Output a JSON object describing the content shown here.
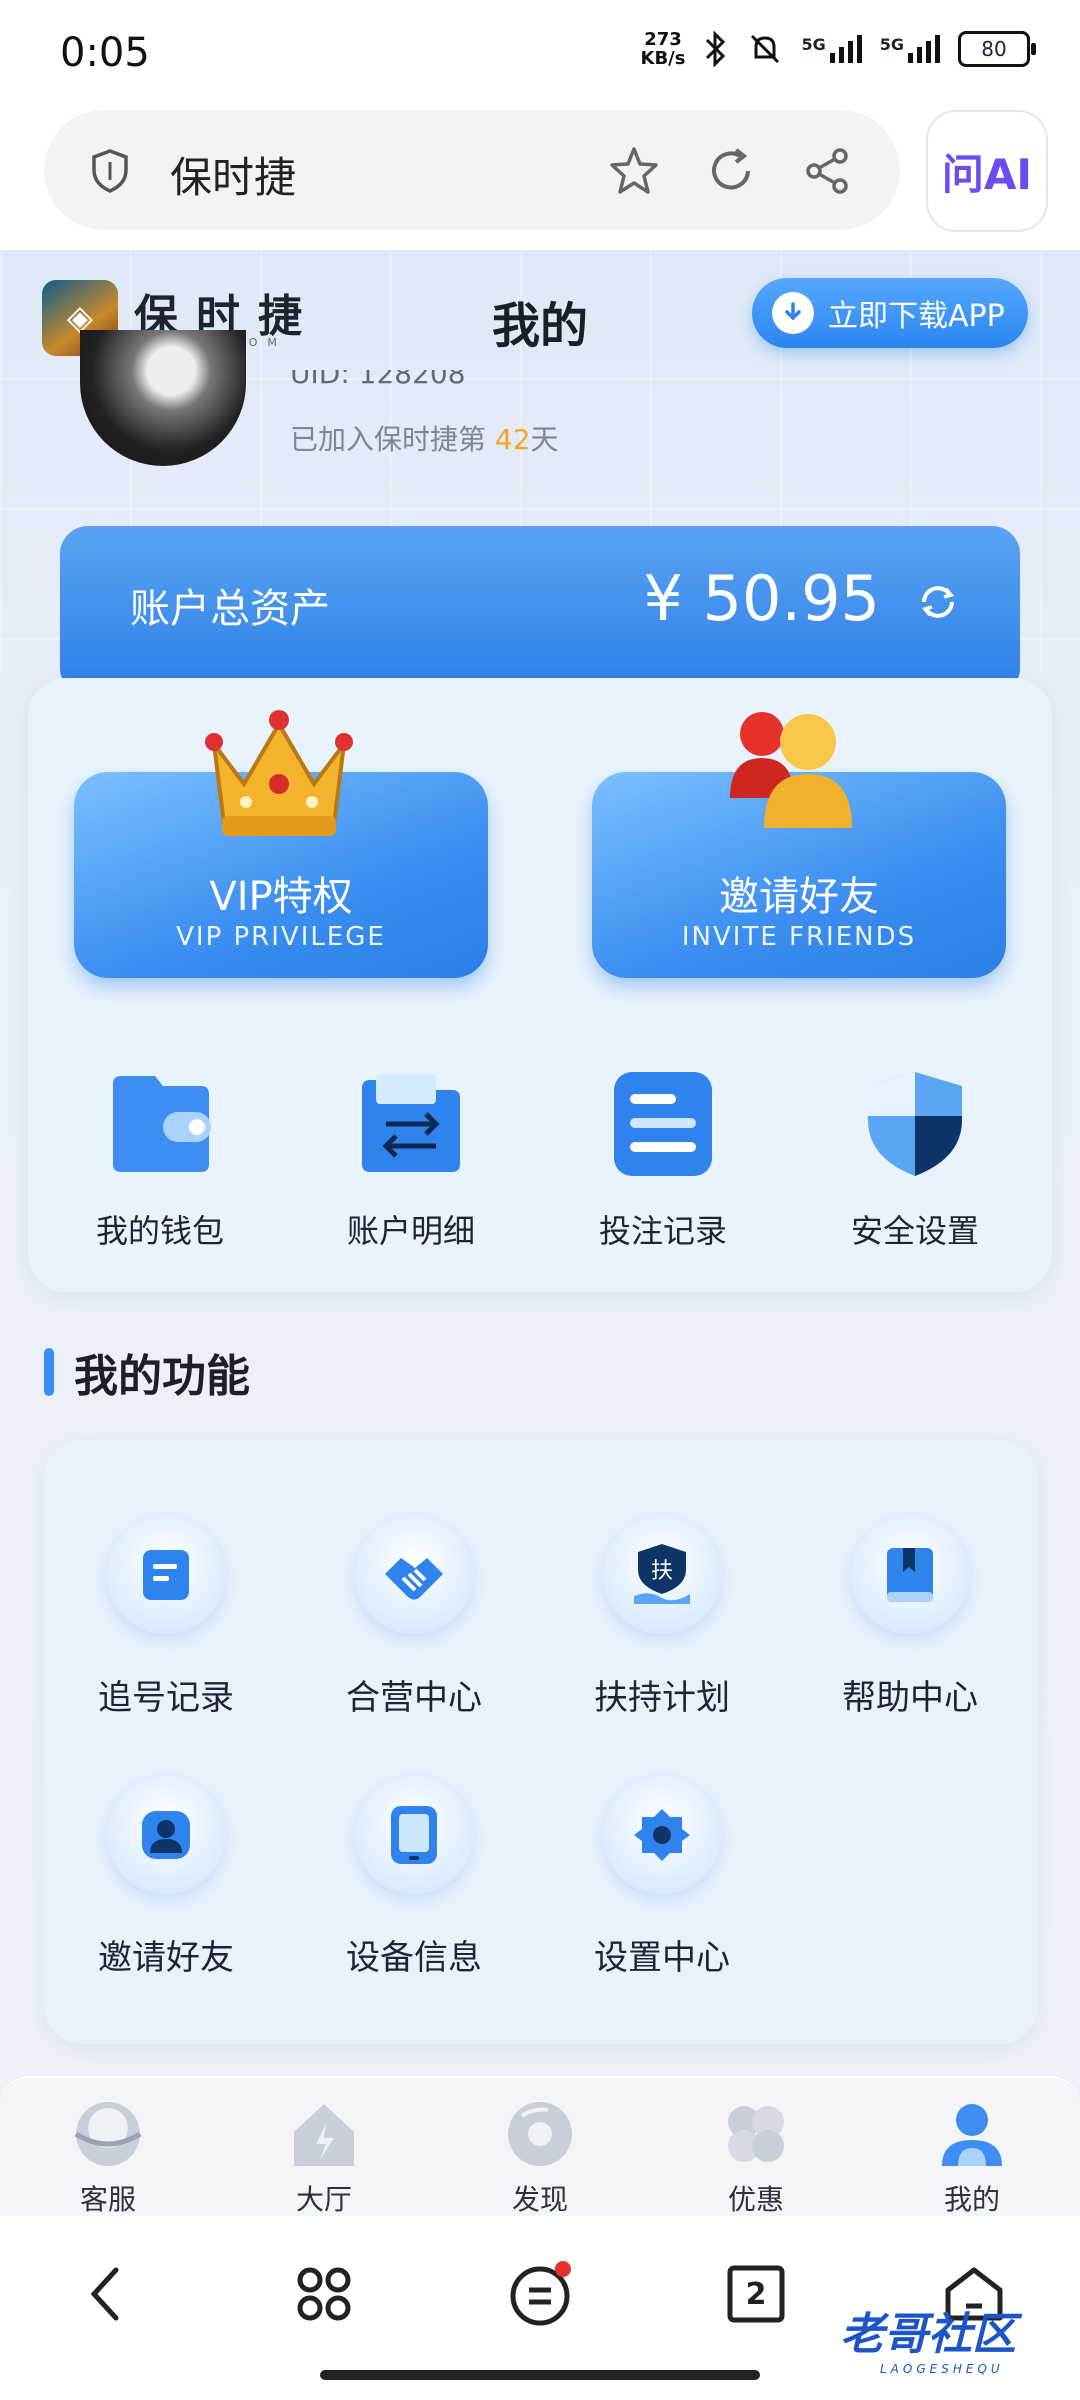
{
  "status_bar": {
    "time": "0:05",
    "net_speed_value": "273",
    "net_speed_unit": "KB/s",
    "signal1_label": "5G",
    "signal2_label": "5G",
    "battery": "80"
  },
  "browser": {
    "page_title": "保时捷",
    "ai_label": "问AI"
  },
  "header": {
    "brand_name": "保时捷",
    "brand_sub": "BSJ28.COM",
    "title": "我的",
    "download_label": "立即下载APP"
  },
  "profile": {
    "uid_partial": "UID: 128208",
    "joined_prefix": "已加入保时捷第 ",
    "joined_days": "42",
    "joined_suffix": "天"
  },
  "assets": {
    "label": "账户总资产",
    "amount": "¥ 50.95"
  },
  "promo": [
    {
      "title": "VIP特权",
      "subtitle": "VIP PRIVILEGE"
    },
    {
      "title": "邀请好友",
      "subtitle": "INVITE FRIENDS"
    }
  ],
  "quick_links": [
    {
      "label": "我的钱包",
      "icon": "wallet-icon"
    },
    {
      "label": "账户明细",
      "icon": "transfer-folder-icon"
    },
    {
      "label": "投注记录",
      "icon": "record-list-icon"
    },
    {
      "label": "安全设置",
      "icon": "shield-icon"
    }
  ],
  "functions": {
    "section_title": "我的功能",
    "items": [
      {
        "label": "追号记录",
        "icon": "note-icon"
      },
      {
        "label": "合营中心",
        "icon": "handshake-icon"
      },
      {
        "label": "扶持计划",
        "icon": "support-hand-icon",
        "icon_text": "扶"
      },
      {
        "label": "帮助中心",
        "icon": "book-icon"
      },
      {
        "label": "邀请好友",
        "icon": "users-icon"
      },
      {
        "label": "设备信息",
        "icon": "tablet-icon"
      },
      {
        "label": "设置中心",
        "icon": "gear-icon"
      }
    ]
  },
  "tabbar": [
    {
      "label": "客服",
      "icon": "support-ball-icon"
    },
    {
      "label": "大厅",
      "icon": "house-icon"
    },
    {
      "label": "发现",
      "icon": "disc-icon"
    },
    {
      "label": "优惠",
      "icon": "clover-icon"
    },
    {
      "label": "我的",
      "icon": "profile-icon",
      "active": true
    }
  ],
  "browser_nav": {
    "tab_count": "2"
  },
  "watermark": {
    "text": "老哥社区",
    "sub": "LAOGESHEQU"
  },
  "colors": {
    "accent_blue": "#2c86f0",
    "highlight_orange": "#f5a623"
  }
}
